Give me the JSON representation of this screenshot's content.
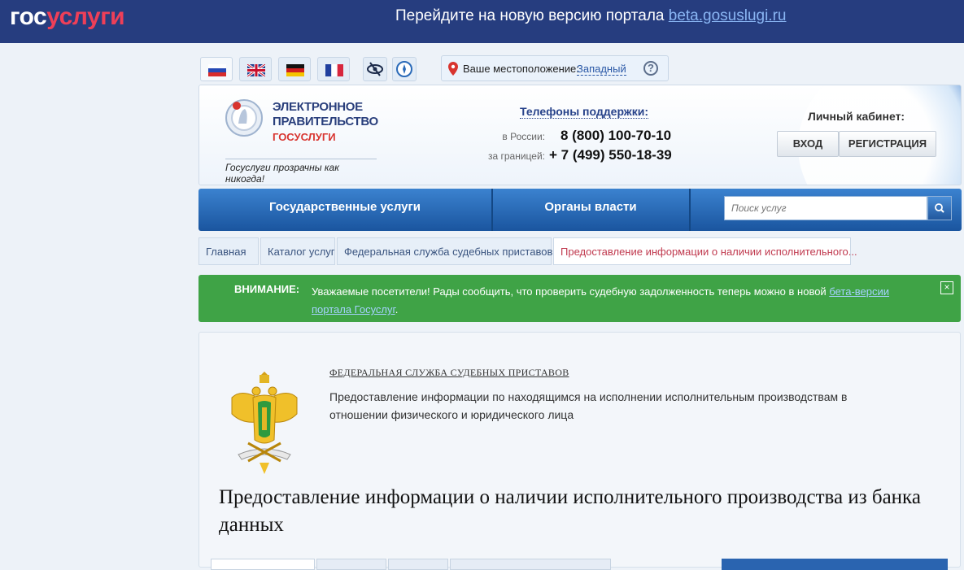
{
  "topbar": {
    "logo_part1": "гос",
    "logo_part2": "услуги",
    "message": "Перейдите на новую версию портала",
    "beta_link": "beta.gosuslugi.ru"
  },
  "languages": [
    "ru",
    "en",
    "de",
    "fr"
  ],
  "location": {
    "label": "Ваше местоположение:",
    "value": "Западный"
  },
  "header": {
    "brand_line1": "ЭЛЕКТРОННОЕ",
    "brand_line2": "ПРАВИТЕЛЬСТВО",
    "brand_line3": "ГОСУСЛУГИ",
    "slogan": "Госуслуги прозрачны как никогда!",
    "phones_title": "Телефоны поддержки",
    "phone_ru_label": "в России:",
    "phone_ru": "8 (800) 100-70-10",
    "phone_abroad_label": "за границей:",
    "phone_abroad": "+ 7 (499) 550-18-39",
    "cabinet_title": "Личный кабинет:",
    "login": "ВХОД",
    "register": "РЕГИСТРАЦИЯ"
  },
  "nav": {
    "services": "Государственные услуги",
    "authorities": "Органы власти",
    "search_placeholder": "Поиск услуг"
  },
  "breadcrumbs": [
    "Главная",
    "Каталог услуг",
    "Федеральная служба судебных приставов",
    "Предоставление информации о наличии исполнительного..."
  ],
  "alert": {
    "label": "ВНИМАНИЕ:",
    "text": "Уважаемые посетители! Рады сообщить, что проверить судебную задолженность теперь можно в новой ",
    "link": "бета-версии портала Госуслуг",
    "tail": ".",
    "close": "×"
  },
  "content": {
    "department": "ФЕДЕРАЛЬНАЯ СЛУЖБА СУДЕБНЫХ ПРИСТАВОВ",
    "description": "Предоставление информации по находящимся на исполнении исполнительным производствам в отношении физического и юридического лица",
    "title": "Предоставление информации о наличии исполнительного производства из банка данных"
  },
  "colors": {
    "topbar": "#263d7f",
    "accent_red": "#d8342f",
    "nav_blue": "#2a6ab8",
    "alert_green": "#3fa346"
  }
}
